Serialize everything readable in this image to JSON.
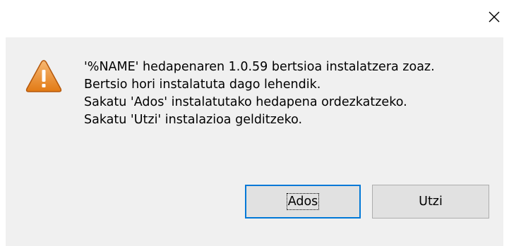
{
  "window": {
    "close_icon": "close-icon"
  },
  "dialog": {
    "icon": "warning-icon",
    "icon_colors": {
      "fill_top": "#f6b873",
      "fill_bottom": "#e27a14",
      "stroke": "#b4580c",
      "glyph": "#ffffff"
    },
    "message_lines": [
      "'%NAME' hedapenaren 1.0.59 bertsioa instalatzera zoaz.",
      "Bertsio hori instalatuta dago lehendik.",
      "Sakatu 'Ados' instalatutako hedapena ordezkatzeko.",
      "Sakatu 'Utzi' instalazioa gelditzeko."
    ],
    "ok_label": "Ados",
    "cancel_label": "Utzi",
    "accent_color": "#0078d7"
  }
}
